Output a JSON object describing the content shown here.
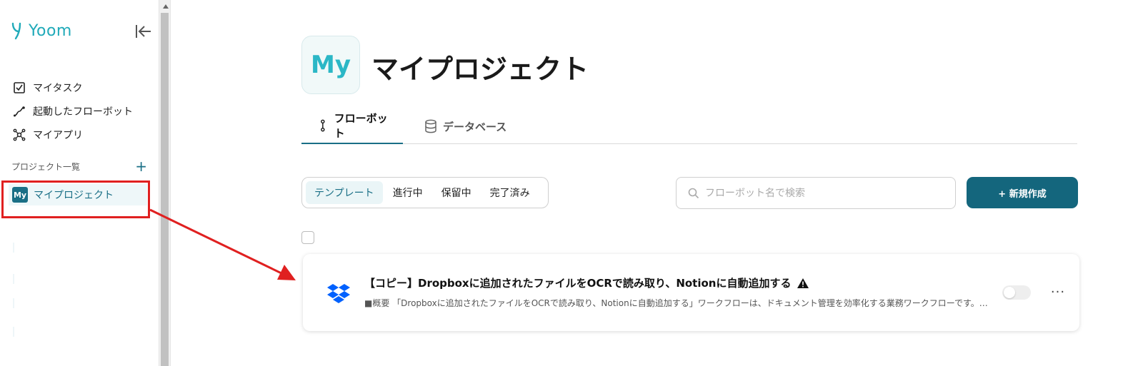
{
  "brand": {
    "name": "Yoom",
    "color": "#20aab9"
  },
  "sidebar": {
    "nav": [
      {
        "label": "マイタスク",
        "icon": "checkbox-icon"
      },
      {
        "label": "起動したフローボット",
        "icon": "flow-run-icon"
      },
      {
        "label": "マイアプリ",
        "icon": "apps-network-icon"
      }
    ],
    "section_label": "プロジェクト一覧",
    "add_symbol": "+",
    "project": {
      "badge": "My",
      "label": "マイプロジェクト"
    }
  },
  "header": {
    "badge": "My",
    "title": "マイプロジェクト"
  },
  "tabs": [
    {
      "label": "フローボット",
      "icon": "flowbot-icon",
      "active": true
    },
    {
      "label": "データベース",
      "icon": "database-icon",
      "active": false
    }
  ],
  "filters": [
    "テンプレート",
    "進行中",
    "保留中",
    "完了済み"
  ],
  "search": {
    "placeholder": "フローボット名で検索"
  },
  "new_button": {
    "label": "+ 新規作成"
  },
  "flows": [
    {
      "title": "【コピー】Dropboxに追加されたファイルをOCRで読み取り、Notionに自動追加する",
      "description": "■概要 「Dropboxに追加されたファイルをOCRで読み取り、Notionに自動追加する」ワークフローは、ドキュメント管理を効率化する業務ワークフローです。…",
      "app_icon": "dropbox-icon",
      "warning_icon": "warning-icon",
      "enabled": false,
      "more_symbol": "···"
    }
  ],
  "colors": {
    "accent": "#14667d",
    "annotation": "#e02020"
  }
}
